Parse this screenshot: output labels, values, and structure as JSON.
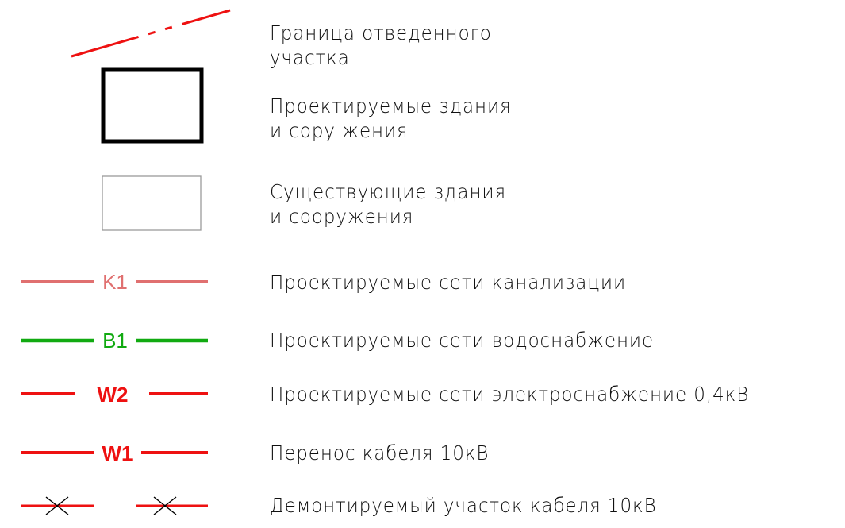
{
  "legend": {
    "items": [
      {
        "id": "boundary",
        "line1": "Граница отведенного",
        "line2": "участка",
        "stroke_color": "#ee1111"
      },
      {
        "id": "designed-buildings",
        "line1": "Проектируемые здания",
        "line2": "и сорy жения",
        "stroke_color": "#000000"
      },
      {
        "id": "existing-buildings",
        "line1": "Существующие здания",
        "line2": "и сооружения",
        "stroke_color": "#9a9a9a"
      },
      {
        "id": "sewer",
        "code": "K1",
        "line1": "Проектируемые сети канализации",
        "stroke_color": "#e07070"
      },
      {
        "id": "water",
        "code": "B1",
        "line1": "Проектируемые сети водоснабжение",
        "stroke_color": "#11aa11"
      },
      {
        "id": "power-04",
        "code": "W2",
        "line1": "Проектируемые сети электроснабжение 0,4кВ",
        "stroke_color": "#ee1111"
      },
      {
        "id": "cable-relocation",
        "code": "W1",
        "line1": "Перенос кабеля 10кВ",
        "stroke_color": "#ee1111"
      },
      {
        "id": "dismantled-cable",
        "line1": "Демонтируемый участок кабеля 10кВ",
        "stroke_color": "#ee1111",
        "mark_color": "#000000"
      }
    ]
  }
}
